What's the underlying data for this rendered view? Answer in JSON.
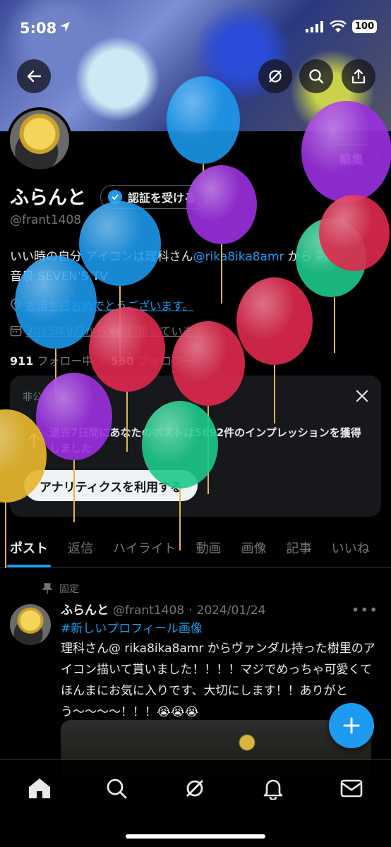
{
  "status": {
    "time": "5:08",
    "battery": "100"
  },
  "profile": {
    "display_name": "ふらんと",
    "verify_label": "認証を受ける",
    "handle": "@frant1408",
    "edit_label": "編集",
    "bio_line1_a": "いい時の自分 アイコンは理科さん",
    "bio_mention": "@rika8ika8amr",
    "bio_line1_b": " から 副",
    "bio_line2": "音泉 SEVEN'S TV",
    "birthday_text": "お誕生日おめでとうございます。",
    "joined_text": "2015年9月からXを利用しています",
    "following_count": "911",
    "following_label": "フォロー中",
    "followers_count": "560",
    "followers_label": "フォロワー"
  },
  "analytics_card": {
    "private_label": "非公開",
    "text": "過去7日間にあなたのポストは5692件のインプレッションを獲得しました",
    "button_label": "アナリティクスを利用する"
  },
  "tabs": [
    "ポスト",
    "返信",
    "ハイライト",
    "動画",
    "画像",
    "記事",
    "いいね"
  ],
  "post": {
    "pinned_label": "固定",
    "name": "ふらんと",
    "handle": "@frant1408",
    "date": "2024/01/24",
    "hashtag": "#新しいプロフィール画像",
    "text": "理科さん@ rika8ika8amr からヴァンダル持った樹里のアイコン描いて貰いました！！！！マジでめっちゃ可愛くてほんまにお気に入りです、大切にします！！ありがとう〜〜〜〜！！！😭😭😭"
  },
  "colors": {
    "accent": "#1d9bf0",
    "background": "#000000",
    "muted": "#71767b"
  },
  "icons": [
    "back-icon",
    "grok-icon",
    "search-icon",
    "share-icon",
    "home-icon",
    "notifications-icon",
    "messages-icon",
    "compose-icon"
  ]
}
